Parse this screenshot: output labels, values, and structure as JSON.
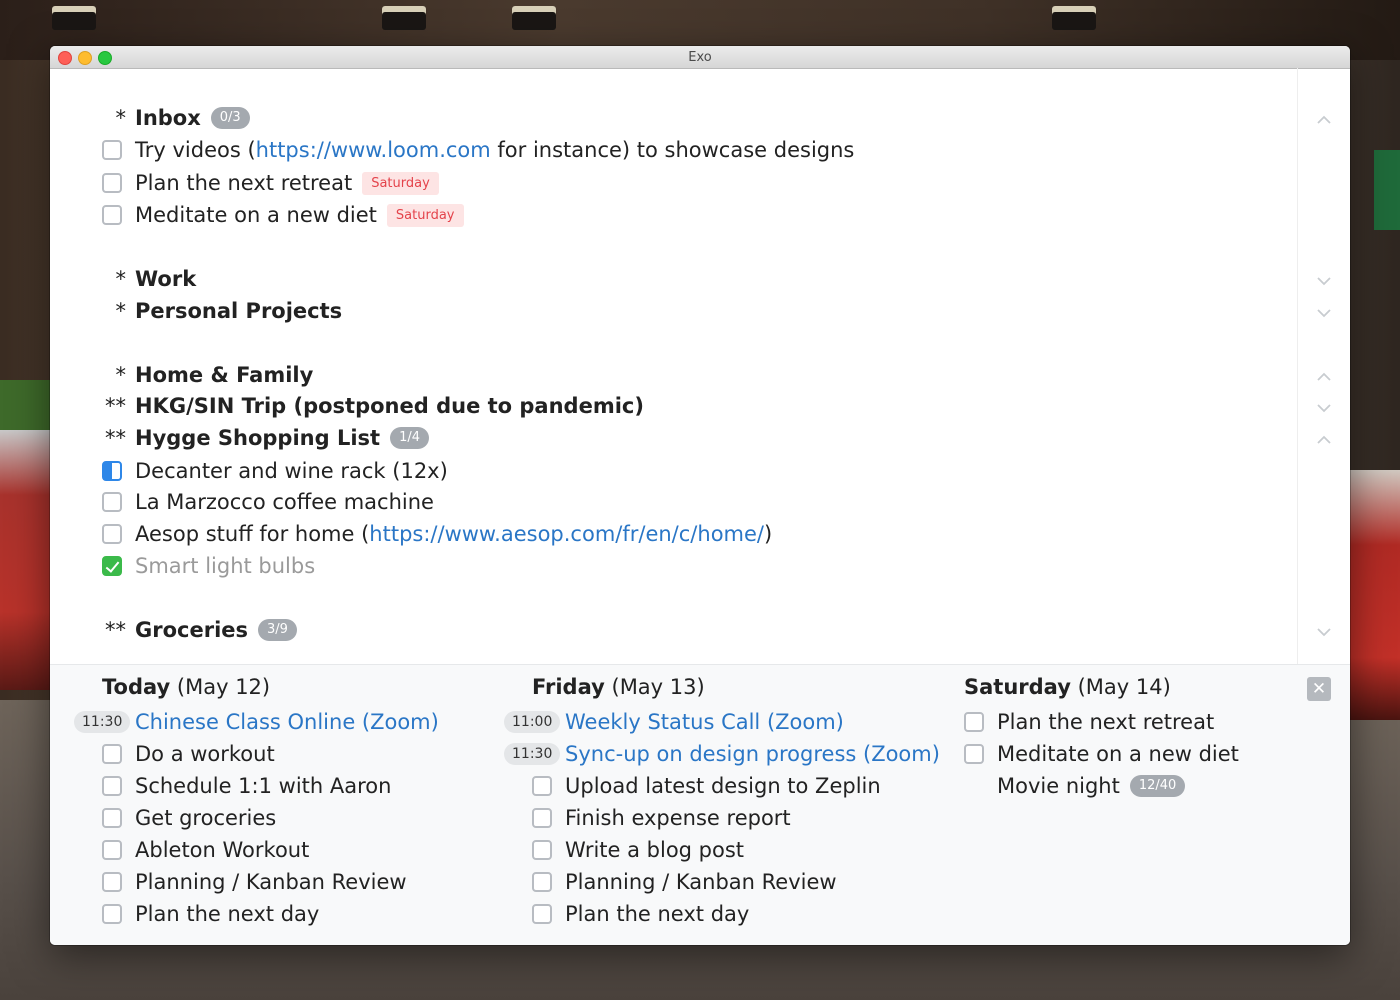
{
  "window": {
    "title": "Exo"
  },
  "sections": {
    "inbox": {
      "stars": "*",
      "title": "Inbox",
      "count": "0/3"
    },
    "work": {
      "stars": "*",
      "title": "Work"
    },
    "personal": {
      "stars": "*",
      "title": "Personal Projects"
    },
    "home": {
      "stars": "*",
      "title": "Home & Family"
    },
    "trip": {
      "stars": "**",
      "title": "HKG/SIN Trip (postponed due to pandemic)"
    },
    "hygge": {
      "stars": "**",
      "title": "Hygge Shopping List",
      "count": "1/4"
    },
    "groceries": {
      "stars": "**",
      "title": "Groceries",
      "count": "3/9"
    }
  },
  "inbox_tasks": [
    {
      "pre": "Try videos (",
      "link": "https://www.loom.com",
      "post": " for instance) to showcase designs"
    },
    {
      "text": "Plan the next retreat",
      "tag": "Saturday"
    },
    {
      "text": "Meditate on a new diet",
      "tag": "Saturday"
    }
  ],
  "hygge_tasks": [
    {
      "text": "Decanter and wine rack (12x)",
      "state": "in-progress"
    },
    {
      "text": "La Marzocco coffee machine",
      "state": "open"
    },
    {
      "pre": "Aesop stuff for home (",
      "link": "https://www.aesop.com/fr/en/c/home/",
      "post": ")",
      "state": "open"
    },
    {
      "text": "Smart light bulbs",
      "state": "done"
    }
  ],
  "agenda": {
    "today": {
      "day": "Today",
      "date": "(May 12)",
      "events": [
        {
          "time": "11:30",
          "title": "Chinese Class Online (Zoom)"
        }
      ],
      "tasks": [
        "Do a workout",
        "Schedule 1:1 with Aaron",
        "Get groceries",
        "Ableton Workout",
        "Planning / Kanban Review",
        "Plan the next day"
      ]
    },
    "friday": {
      "day": "Friday",
      "date": "(May 13)",
      "events": [
        {
          "time": "11:00",
          "title": "Weekly Status Call (Zoom)"
        },
        {
          "time": "11:30",
          "title": "Sync-up on design progress (Zoom)"
        }
      ],
      "tasks": [
        "Upload latest design to Zeplin",
        "Finish expense report",
        "Write a blog post",
        "Planning / Kanban Review",
        "Plan the next day"
      ]
    },
    "saturday": {
      "day": "Saturday",
      "date": "(May 14)",
      "tasks": [
        "Plan the next retreat",
        "Meditate on a new diet"
      ],
      "note": {
        "text": "Movie night",
        "count": "12/40"
      }
    },
    "close_label": "✕"
  },
  "icons": {
    "collapse": "chevron-up-icon",
    "expand": "chevron-down-icon"
  },
  "colors": {
    "link": "#2a76c6",
    "tag_text": "#e4434b",
    "tag_bg": "#fde4e4",
    "check_done": "#3bba4a",
    "check_progress": "#2e87e8"
  }
}
